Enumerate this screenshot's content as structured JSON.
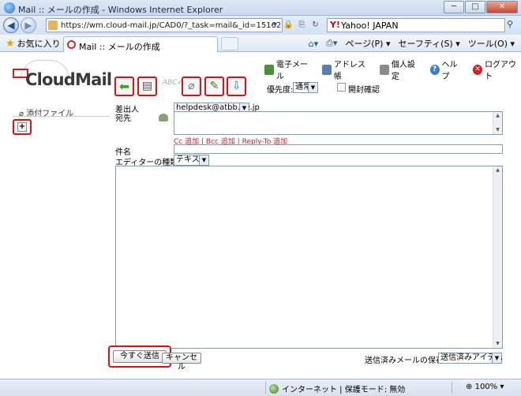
{
  "window": {
    "title": "Mail :: メールの作成 - Windows Internet Explorer",
    "minimize": "─",
    "maximize": "□",
    "close": "✕"
  },
  "addressbar": {
    "url": "https://wm.cloud-mail.jp/CAD0/?_task=mail&_id=1516255583",
    "search_provider": "Yahoo! JAPAN"
  },
  "commandbar": {
    "favorites": "お気に入り",
    "tab_title": "Mail :: メールの作成",
    "page": "ページ(P) ▾",
    "safety": "セーフティ(S) ▾",
    "tools": "ツール(O) ▾"
  },
  "app": {
    "logo": "CloudMail",
    "nav": {
      "mail": "電子メール",
      "addressbook": "アドレス帳",
      "settings": "個人設定",
      "help": "ヘルプ",
      "logout": "ログアウト"
    },
    "toolbar": {
      "spell": "ABC"
    },
    "priority_label": "優先度:",
    "priority_value": "通常",
    "read_receipt": "開封確認"
  },
  "attachments": {
    "header": "添付ファイル",
    "add": "+"
  },
  "compose": {
    "from_label": "差出人",
    "from_value": "helpdesk@atbb.ne.jp",
    "to_label": "宛先",
    "cc_link": "Cc 追加",
    "bcc_link": "Bcc 追加",
    "replyto_link": "Reply-To 追加",
    "separator": "|",
    "subject_label": "件名",
    "editor_label": "エディターの種類",
    "editor_value": "テキスト",
    "send_button": "今すぐ送信",
    "cancel_button": "キャンセル",
    "save_label": "送信済みメールの保存先:",
    "save_value": "送信済みアイテム"
  },
  "statusbar": {
    "zone": "インターネット | 保護モード: 無効",
    "zoom": "100%"
  }
}
